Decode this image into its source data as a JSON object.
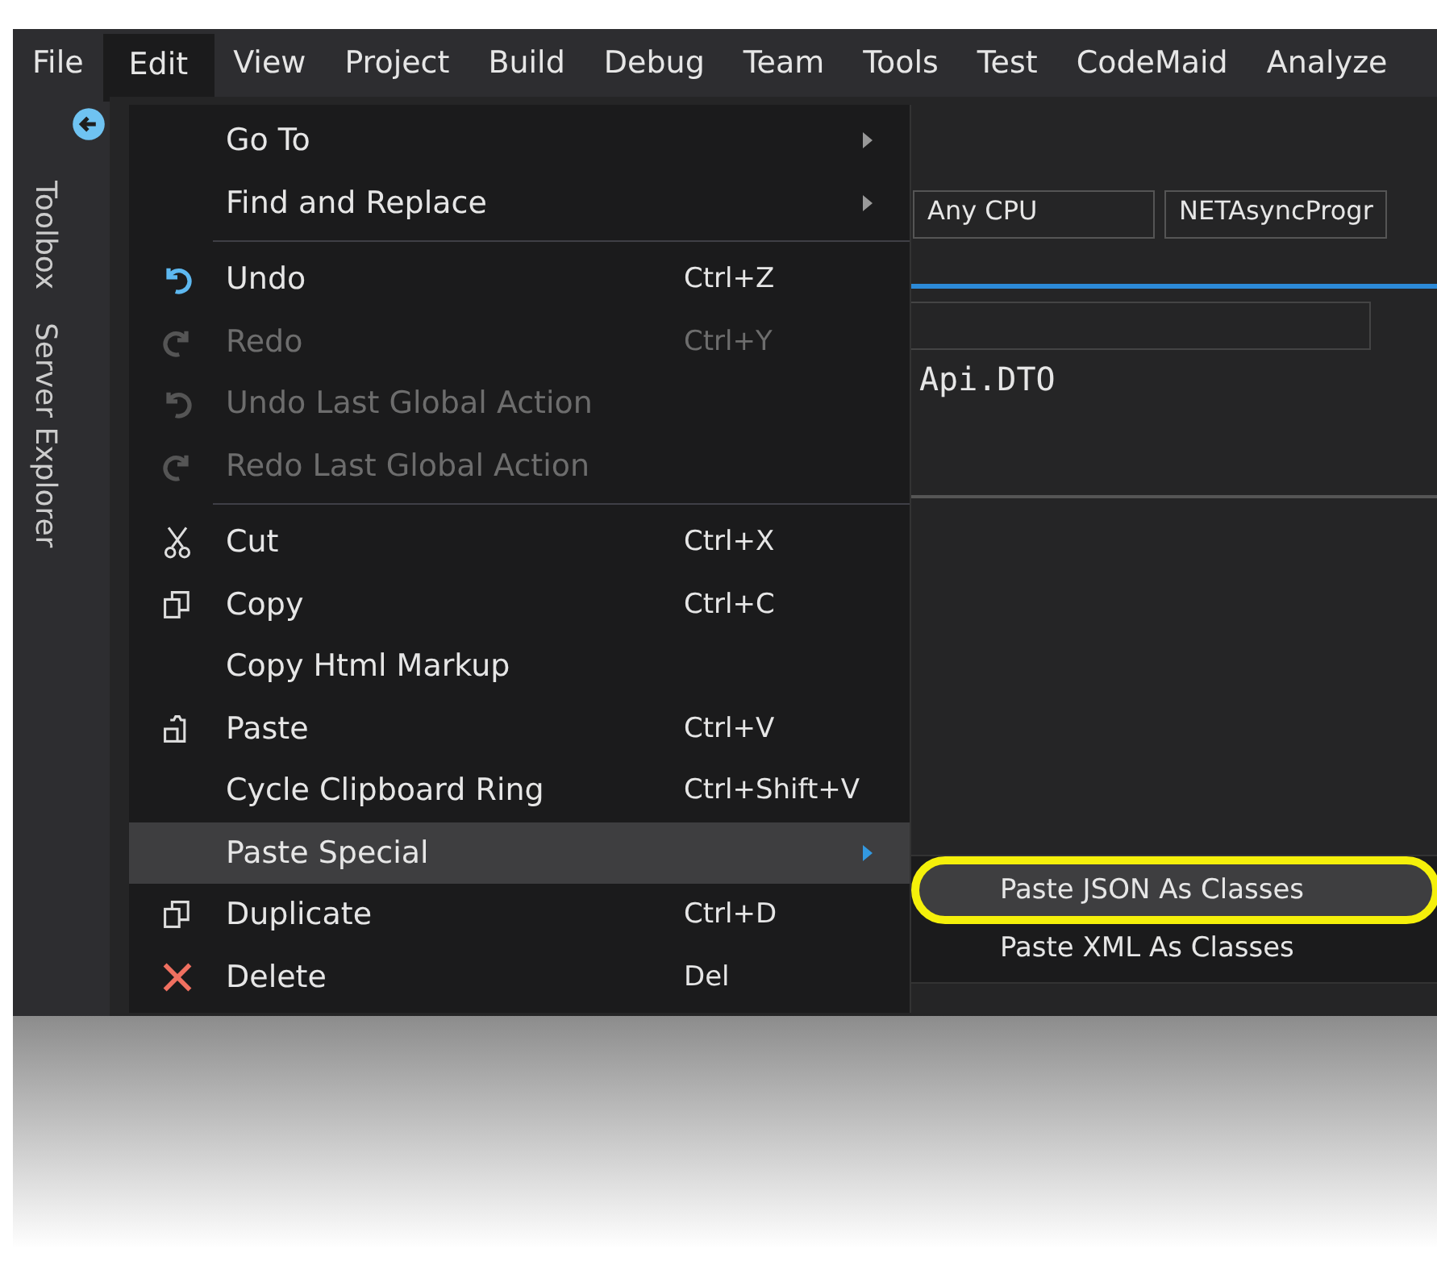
{
  "menu_bar": [
    {
      "label": "File",
      "selected": false
    },
    {
      "label": "Edit",
      "selected": true
    },
    {
      "label": "View",
      "selected": false
    },
    {
      "label": "Project",
      "selected": false
    },
    {
      "label": "Build",
      "selected": false
    },
    {
      "label": "Debug",
      "selected": false
    },
    {
      "label": "Team",
      "selected": false
    },
    {
      "label": "Tools",
      "selected": false
    },
    {
      "label": "Test",
      "selected": false
    },
    {
      "label": "CodeMaid",
      "selected": false
    },
    {
      "label": "Analyze",
      "selected": false
    }
  ],
  "side_tabs": [
    "Toolbox",
    "Server Explorer"
  ],
  "toolbar": {
    "dropdowns": [
      "Any CPU",
      "NETAsyncProgr"
    ]
  },
  "editor": {
    "text": "Api.DTO"
  },
  "edit_menu": [
    {
      "kind": "plain",
      "label": "Go To",
      "submenu": true,
      "disabled": false,
      "selected": false
    },
    {
      "kind": "plain",
      "label": "Find and Replace",
      "submenu": true,
      "disabled": false,
      "selected": false
    },
    {
      "kind": "separator"
    },
    {
      "kind": "undo",
      "label": "Undo",
      "shortcut": "Ctrl+Z",
      "disabled": false,
      "selected": false
    },
    {
      "kind": "redo",
      "label": "Redo",
      "shortcut": "Ctrl+Y",
      "disabled": true,
      "selected": false
    },
    {
      "kind": "undo",
      "label": "Undo Last Global Action",
      "disabled": true,
      "selected": false
    },
    {
      "kind": "redo",
      "label": "Redo Last Global Action",
      "disabled": true,
      "selected": false
    },
    {
      "kind": "separator"
    },
    {
      "kind": "cut",
      "label": "Cut",
      "shortcut": "Ctrl+X",
      "disabled": false,
      "selected": false
    },
    {
      "kind": "copy",
      "label": "Copy",
      "shortcut": "Ctrl+C",
      "disabled": false,
      "selected": false
    },
    {
      "kind": "plain",
      "label": "Copy Html Markup",
      "disabled": false,
      "selected": false
    },
    {
      "kind": "paste",
      "label": "Paste",
      "shortcut": "Ctrl+V",
      "disabled": false,
      "selected": false
    },
    {
      "kind": "plain",
      "label": "Cycle Clipboard Ring",
      "shortcut": "Ctrl+Shift+V",
      "disabled": false,
      "selected": false
    },
    {
      "kind": "plain",
      "label": "Paste Special",
      "submenu": true,
      "disabled": false,
      "selected": true
    },
    {
      "kind": "copy",
      "label": "Duplicate",
      "shortcut": "Ctrl+D",
      "disabled": false,
      "selected": false
    },
    {
      "kind": "delete",
      "label": "Delete",
      "shortcut": "Del",
      "disabled": false,
      "selected": false
    }
  ],
  "paste_special_menu": [
    {
      "label": "Paste JSON As Classes",
      "selected": true,
      "circled": true
    },
    {
      "label": "Paste XML As Classes",
      "selected": false,
      "circled": false
    }
  ]
}
